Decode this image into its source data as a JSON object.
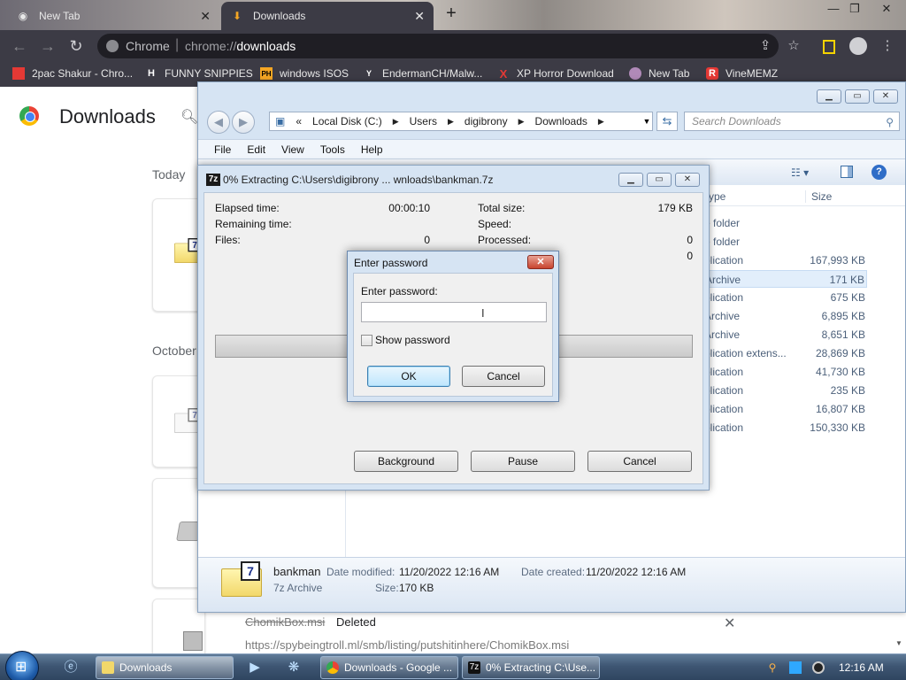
{
  "chrome": {
    "tabs": [
      {
        "label": "New Tab",
        "active": false
      },
      {
        "label": "Downloads",
        "active": true
      }
    ],
    "omnibox": {
      "site": "Chrome",
      "scheme": "chrome://",
      "path": "downloads"
    },
    "bookmarks": [
      {
        "label": "2pac Shakur - Chro...",
        "icon": "bookmark-icon"
      },
      {
        "label": "FUNNY SNIPPIES",
        "icon": "h-icon"
      },
      {
        "label": "windows ISOS",
        "icon": "ph-icon"
      },
      {
        "label": "EndermanCH/Malw...",
        "icon": "yt-icon"
      },
      {
        "label": "XP Horror Download",
        "icon": "x-icon"
      },
      {
        "label": "New Tab",
        "icon": "globe-icon"
      },
      {
        "label": "VineMEMZ",
        "icon": "r-icon"
      }
    ]
  },
  "downloads_page": {
    "title": "Downloads",
    "sections": [
      "Today",
      "October"
    ],
    "deleted_item": {
      "name": "ChomikBox.msi",
      "status": "Deleted",
      "url": "https://spybeingtroll.ml/smb/listing/putshitinhere/ChomikBox.msi"
    }
  },
  "explorer": {
    "breadcrumb": [
      "«",
      "Local Disk (C:)",
      "Users",
      "digibrony",
      "Downloads"
    ],
    "search_placeholder": "Search Downloads",
    "menu": [
      "File",
      "Edit",
      "View",
      "Tools",
      "Help"
    ],
    "columns": {
      "type": "ype",
      "size": "Size"
    },
    "rows": [
      {
        "type": "e folder",
        "size": ""
      },
      {
        "type": "e folder",
        "size": ""
      },
      {
        "type": "plication",
        "size": "167,993 KB"
      },
      {
        "type": "Archive",
        "size": "171 KB",
        "selected": true
      },
      {
        "type": "plication",
        "size": "675 KB"
      },
      {
        "type": "Archive",
        "size": "6,895 KB"
      },
      {
        "type": "Archive",
        "size": "8,651 KB"
      },
      {
        "type": "plication extens...",
        "size": "28,869 KB"
      },
      {
        "type": "plication",
        "size": "41,730 KB"
      },
      {
        "type": "plication",
        "size": "235 KB"
      },
      {
        "type": "plication",
        "size": "16,807 KB"
      },
      {
        "type": "plication",
        "size": "150,330 KB"
      }
    ],
    "details": {
      "name": "bankman",
      "type": "7z Archive",
      "modified_label": "Date modified:",
      "modified": "11/20/2022 12:16 AM",
      "created_label": "Date created:",
      "created": "11/20/2022 12:16 AM",
      "size_label": "Size:",
      "size": "170 KB"
    }
  },
  "sevenzip": {
    "title": "0% Extracting C:\\Users\\digibrony ... wnloads\\bankman.7z",
    "elapsed_label": "Elapsed time:",
    "elapsed": "00:00:10",
    "remaining_label": "Remaining time:",
    "files_label": "Files:",
    "files": "0",
    "total_label": "Total size:",
    "total": "179 KB",
    "speed_label": "Speed:",
    "processed_label": "Processed:",
    "processed": "0",
    "extra_value": "0",
    "progress": 0,
    "buttons": {
      "background": "Background",
      "pause": "Pause",
      "cancel": "Cancel"
    }
  },
  "password_dialog": {
    "title": "Enter password",
    "label": "Enter password:",
    "value": "",
    "show_password_label": "Show password",
    "show_password_checked": false,
    "ok": "OK",
    "cancel": "Cancel"
  },
  "taskbar": {
    "tasks": [
      {
        "label": "Downloads",
        "icon": "explorer-icon"
      },
      {
        "label": "Downloads - Google ...",
        "icon": "chrome-icon"
      },
      {
        "label": "0% Extracting C:\\Use...",
        "icon": "7zip-icon"
      }
    ],
    "clock": "12:16 AM"
  }
}
